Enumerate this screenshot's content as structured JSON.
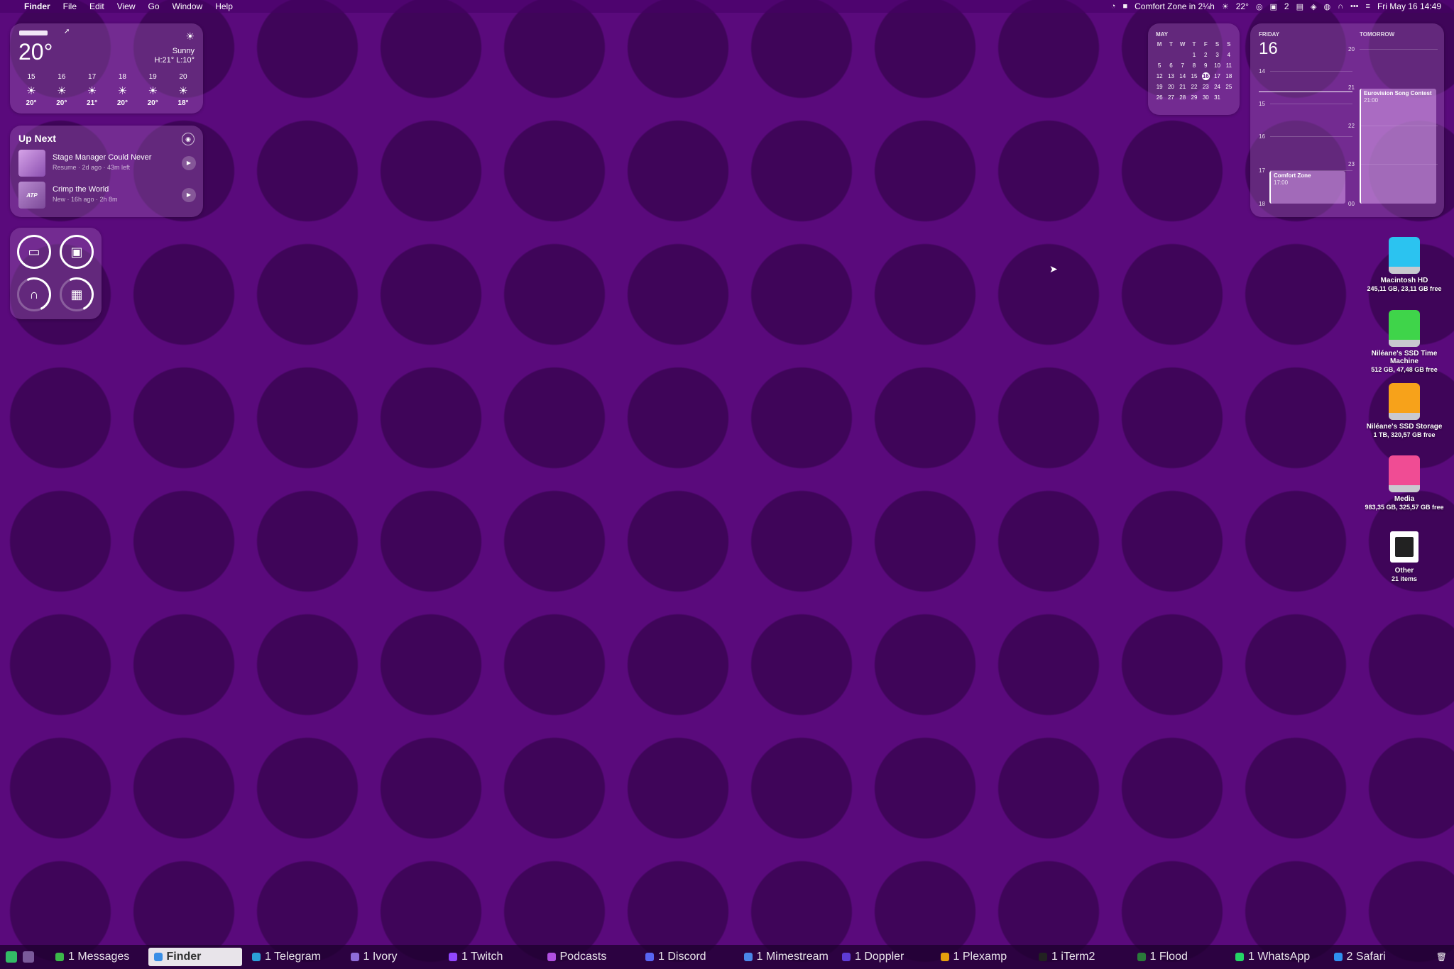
{
  "menubar": {
    "app": "Finder",
    "menus": [
      "File",
      "Edit",
      "View",
      "Go",
      "Window",
      "Help"
    ],
    "status_event": "Comfort Zone in 2¼h",
    "status_temp": "22°",
    "status_count": "2",
    "datetime": "Fri May 16  14:49"
  },
  "weather": {
    "temp": "20°",
    "condition": "Sunny",
    "hilo": "H:21° L:10°",
    "days": [
      {
        "d": "15",
        "t": "20°"
      },
      {
        "d": "16",
        "t": "20°"
      },
      {
        "d": "17",
        "t": "21°"
      },
      {
        "d": "18",
        "t": "20°"
      },
      {
        "d": "19",
        "t": "20°"
      },
      {
        "d": "20",
        "t": "18°"
      }
    ]
  },
  "upnext": {
    "title": "Up Next",
    "episodes": [
      {
        "name": "Stage Manager Could Never",
        "meta": "Resume · 2d ago · 43m left"
      },
      {
        "name": "Crimp the World",
        "meta": "New · 16h ago · 2h 8m",
        "art": "ATP"
      }
    ]
  },
  "battery": {
    "devices": [
      "laptop-icon",
      "case-icon",
      "headphones-icon",
      "keyboard-icon"
    ],
    "levels": [
      1.0,
      1.0,
      0.6,
      0.35
    ]
  },
  "mini_calendar": {
    "month": "MAY",
    "headers": [
      "M",
      "T",
      "W",
      "T",
      "F",
      "S",
      "S"
    ],
    "weeks": [
      [
        "",
        "",
        "",
        "1",
        "2",
        "3",
        "4"
      ],
      [
        "5",
        "6",
        "7",
        "8",
        "9",
        "10",
        "11"
      ],
      [
        "12",
        "13",
        "14",
        "15",
        "16",
        "17",
        "18"
      ],
      [
        "19",
        "20",
        "21",
        "22",
        "23",
        "24",
        "25"
      ],
      [
        "26",
        "27",
        "28",
        "29",
        "30",
        "31",
        ""
      ]
    ],
    "today": "16"
  },
  "day_calendar": {
    "day_label": "FRIDAY",
    "day_num": "16",
    "tomorrow_label": "TOMORROW",
    "left_hours": [
      "14",
      "15",
      "16",
      "17",
      "18"
    ],
    "right_hours": [
      "20",
      "21",
      "22",
      "23",
      "00"
    ],
    "event_today": {
      "title": "Comfort Zone",
      "time": "17:00"
    },
    "event_tomorrow": {
      "title": "Eurovision Song Contest",
      "time": "21:00"
    }
  },
  "desktop": [
    {
      "name": "Macintosh HD",
      "sub": "245,11 GB, 23,11 GB free",
      "color": "#2bc3f0"
    },
    {
      "name": "Niléane's SSD Time Machine",
      "sub": "512 GB, 47,48 GB free",
      "color": "#3fd44a"
    },
    {
      "name": "Niléane's SSD Storage",
      "sub": "1 TB, 320,57 GB free",
      "color": "#f7a21a"
    },
    {
      "name": "Media",
      "sub": "983,35 GB, 325,57 GB free",
      "color": "#f04c94"
    },
    {
      "name": "Other",
      "sub": "21 items"
    }
  ],
  "taskbar": [
    {
      "label": "1 Messages",
      "color": "#3cb84a"
    },
    {
      "label": "Finder",
      "color": "#3a8ee6"
    },
    {
      "label": "1 Telegram",
      "color": "#2b9fd9"
    },
    {
      "label": "1 Ivory",
      "color": "#8e6bd8"
    },
    {
      "label": "1 Twitch",
      "color": "#9146ff"
    },
    {
      "label": "Podcasts",
      "color": "#b04fe0"
    },
    {
      "label": "1 Discord",
      "color": "#5865f2"
    },
    {
      "label": "1 Mimestream",
      "color": "#4a86e8"
    },
    {
      "label": "1 Doppler",
      "color": "#5e3bd6"
    },
    {
      "label": "1 Plexamp",
      "color": "#e5a00d"
    },
    {
      "label": "1 iTerm2",
      "color": "#222222"
    },
    {
      "label": "1 Flood",
      "color": "#2a7a3a"
    },
    {
      "label": "1 WhatsApp",
      "color": "#25d366"
    },
    {
      "label": "2 Safari",
      "color": "#2f8ff0"
    }
  ]
}
